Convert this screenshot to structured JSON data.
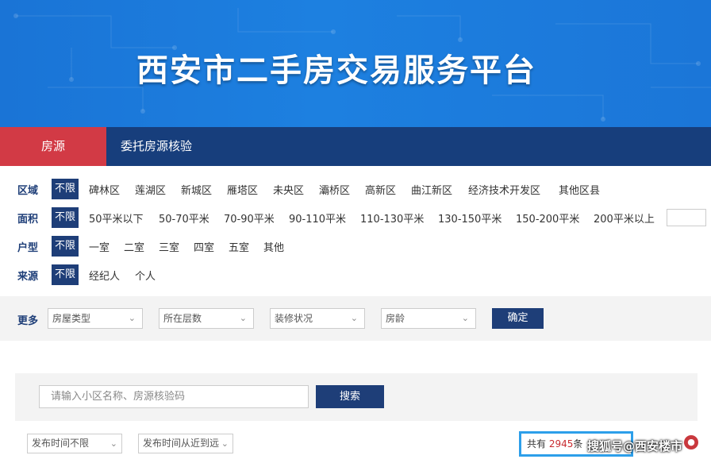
{
  "banner": {
    "title": "西安市二手房交易服务平台"
  },
  "nav": {
    "tabs": [
      {
        "label": "房源"
      },
      {
        "label": "委托房源核验"
      }
    ]
  },
  "filters": {
    "district": {
      "label": "区域",
      "options": [
        "不限",
        "碑林区",
        "莲湖区",
        "新城区",
        "雁塔区",
        "未央区",
        "灞桥区",
        "高新区",
        "曲江新区",
        "经济技术开发区",
        "其他区县"
      ]
    },
    "area": {
      "label": "面积",
      "options": [
        "不限",
        "50平米以下",
        "50-70平米",
        "70-90平米",
        "90-110平米",
        "110-130平米",
        "130-150平米",
        "150-200平米",
        "200平米以上"
      ]
    },
    "layout": {
      "label": "户型",
      "options": [
        "不限",
        "一室",
        "二室",
        "三室",
        "四室",
        "五室",
        "其他"
      ]
    },
    "source": {
      "label": "来源",
      "options": [
        "不限",
        "经纪人",
        "个人"
      ]
    }
  },
  "more": {
    "label": "更多",
    "dropdowns": [
      "房屋类型",
      "所在层数",
      "装修状况",
      "房龄"
    ],
    "confirm_label": "确定"
  },
  "search": {
    "placeholder": "请输入小区名称、房源核验码",
    "button_label": "搜索"
  },
  "sort": {
    "publish_time": "发布时间不限",
    "publish_order": "发布时间从近到远"
  },
  "results": {
    "prefix": "共有",
    "count": "2945",
    "suffix": "条"
  },
  "watermark": "搜狐号@西安楼市",
  "colors": {
    "navy": "#1e3e78",
    "red_tab": "#d23a45",
    "banner_blue": "#1d80e0",
    "highlight": "#2d9fea"
  }
}
